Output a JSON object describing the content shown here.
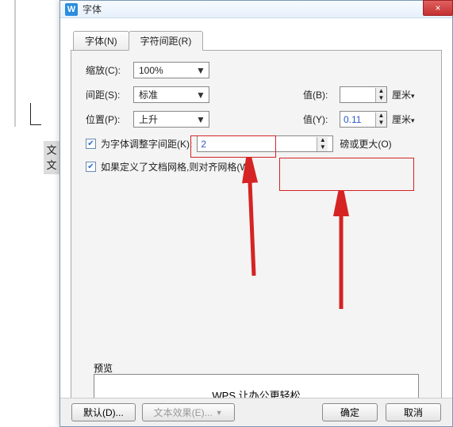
{
  "window": {
    "title": "字体",
    "close_glyph": "×",
    "app_glyph": "W"
  },
  "tabs": {
    "font": "字体(N)",
    "spacing": "字符间距(R)"
  },
  "zoom": {
    "label": "缩放(C):",
    "value": "100%"
  },
  "spacing": {
    "label": "间距(S):",
    "value": "标准",
    "value_b_label": "值(B):",
    "value_b": "",
    "unit_b": "厘米"
  },
  "position": {
    "label": "位置(P):",
    "value": "上升",
    "value_y_label": "值(Y):",
    "value_y": "0.11",
    "unit_y": "厘米"
  },
  "kerning": {
    "label": "为字体调整字间距(K):",
    "value": "2",
    "suffix": "磅或更大(O)"
  },
  "grid": {
    "label": "如果定义了文档网格,则对齐网格(W)"
  },
  "preview": {
    "label": "预览",
    "text": "WPS 让办公更轻松"
  },
  "footer": {
    "default": "默认(D)...",
    "text_effects": "文本效果(E)...",
    "ok": "确定",
    "cancel": "取消"
  },
  "side_text": "文\n文"
}
